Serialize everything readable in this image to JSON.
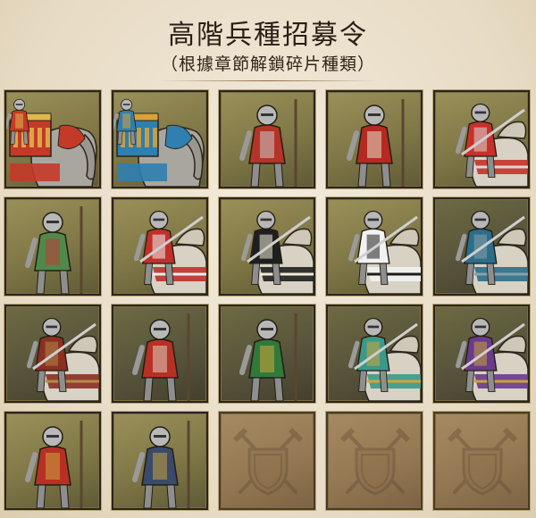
{
  "header": {
    "title": "高階兵種招募令",
    "subtitle": "（根據章節解鎖碎片種類）"
  },
  "colors": {
    "card_bg": "#867c4a",
    "locked_bg": "#957955",
    "frame": "#2b2519",
    "title_text": "#2a1e14"
  },
  "units": [
    {
      "id": "war-elephant-red",
      "locked": false,
      "accent": "#c33a28",
      "trim": "#e0b84a",
      "mount": "elephant"
    },
    {
      "id": "war-elephant-blue",
      "locked": false,
      "accent": "#2f7fb0",
      "trim": "#d9a338",
      "mount": "elephant"
    },
    {
      "id": "armored-foot-knight",
      "locked": false,
      "accent": "#b53327",
      "trim": "#c9c9c9",
      "mount": "none"
    },
    {
      "id": "templar-archer",
      "locked": false,
      "accent": "#b42a22",
      "trim": "#e8dfc4",
      "mount": "none"
    },
    {
      "id": "mounted-knight-red",
      "locked": false,
      "accent": "#c8312a",
      "trim": "#d8d8d8",
      "mount": "horse"
    },
    {
      "id": "green-shield-soldier",
      "locked": false,
      "accent": "#4f8a4a",
      "trim": "#c43a3a",
      "mount": "none"
    },
    {
      "id": "crusader-cavalry",
      "locked": false,
      "accent": "#c0302a",
      "trim": "#eeeeee",
      "mount": "horse"
    },
    {
      "id": "teutonic-knight",
      "locked": false,
      "accent": "#1f1f1f",
      "trim": "#f1ecd8",
      "mount": "horse"
    },
    {
      "id": "hospitaller-knight",
      "locked": false,
      "accent": "#f2f2f2",
      "trim": "#1c1c1c",
      "mount": "horse"
    },
    {
      "id": "blue-lancer",
      "locked": false,
      "accent": "#2a6e8c",
      "trim": "#8aa0a8",
      "mount": "horse"
    },
    {
      "id": "horse-archer",
      "locked": false,
      "accent": "#8a2f22",
      "trim": "#b58b4a",
      "mount": "horse"
    },
    {
      "id": "winged-hussar",
      "locked": false,
      "accent": "#b83024",
      "trim": "#d9d2c2",
      "mount": "none"
    },
    {
      "id": "conquistador-arquebusier",
      "locked": false,
      "accent": "#2f7a3b",
      "trim": "#d0a53a",
      "mount": "none"
    },
    {
      "id": "heavy-lancer-cyan",
      "locked": false,
      "accent": "#3a9a8a",
      "trim": "#d3a53a",
      "mount": "horse"
    },
    {
      "id": "purple-lancer",
      "locked": false,
      "accent": "#6b3a8c",
      "trim": "#c9a23a",
      "mount": "horse"
    },
    {
      "id": "plumed-halberdier",
      "locked": false,
      "accent": "#b83024",
      "trim": "#caa63e",
      "mount": "none"
    },
    {
      "id": "pikeman",
      "locked": false,
      "accent": "#3a4a6a",
      "trim": "#c7a23c",
      "mount": "none"
    },
    {
      "id": "locked-slot-1",
      "locked": true,
      "icon": "crossed-swords-shield-icon"
    },
    {
      "id": "locked-slot-2",
      "locked": true,
      "icon": "crossed-swords-shield-icon"
    },
    {
      "id": "locked-slot-3",
      "locked": true,
      "icon": "crossed-swords-shield-icon"
    }
  ]
}
